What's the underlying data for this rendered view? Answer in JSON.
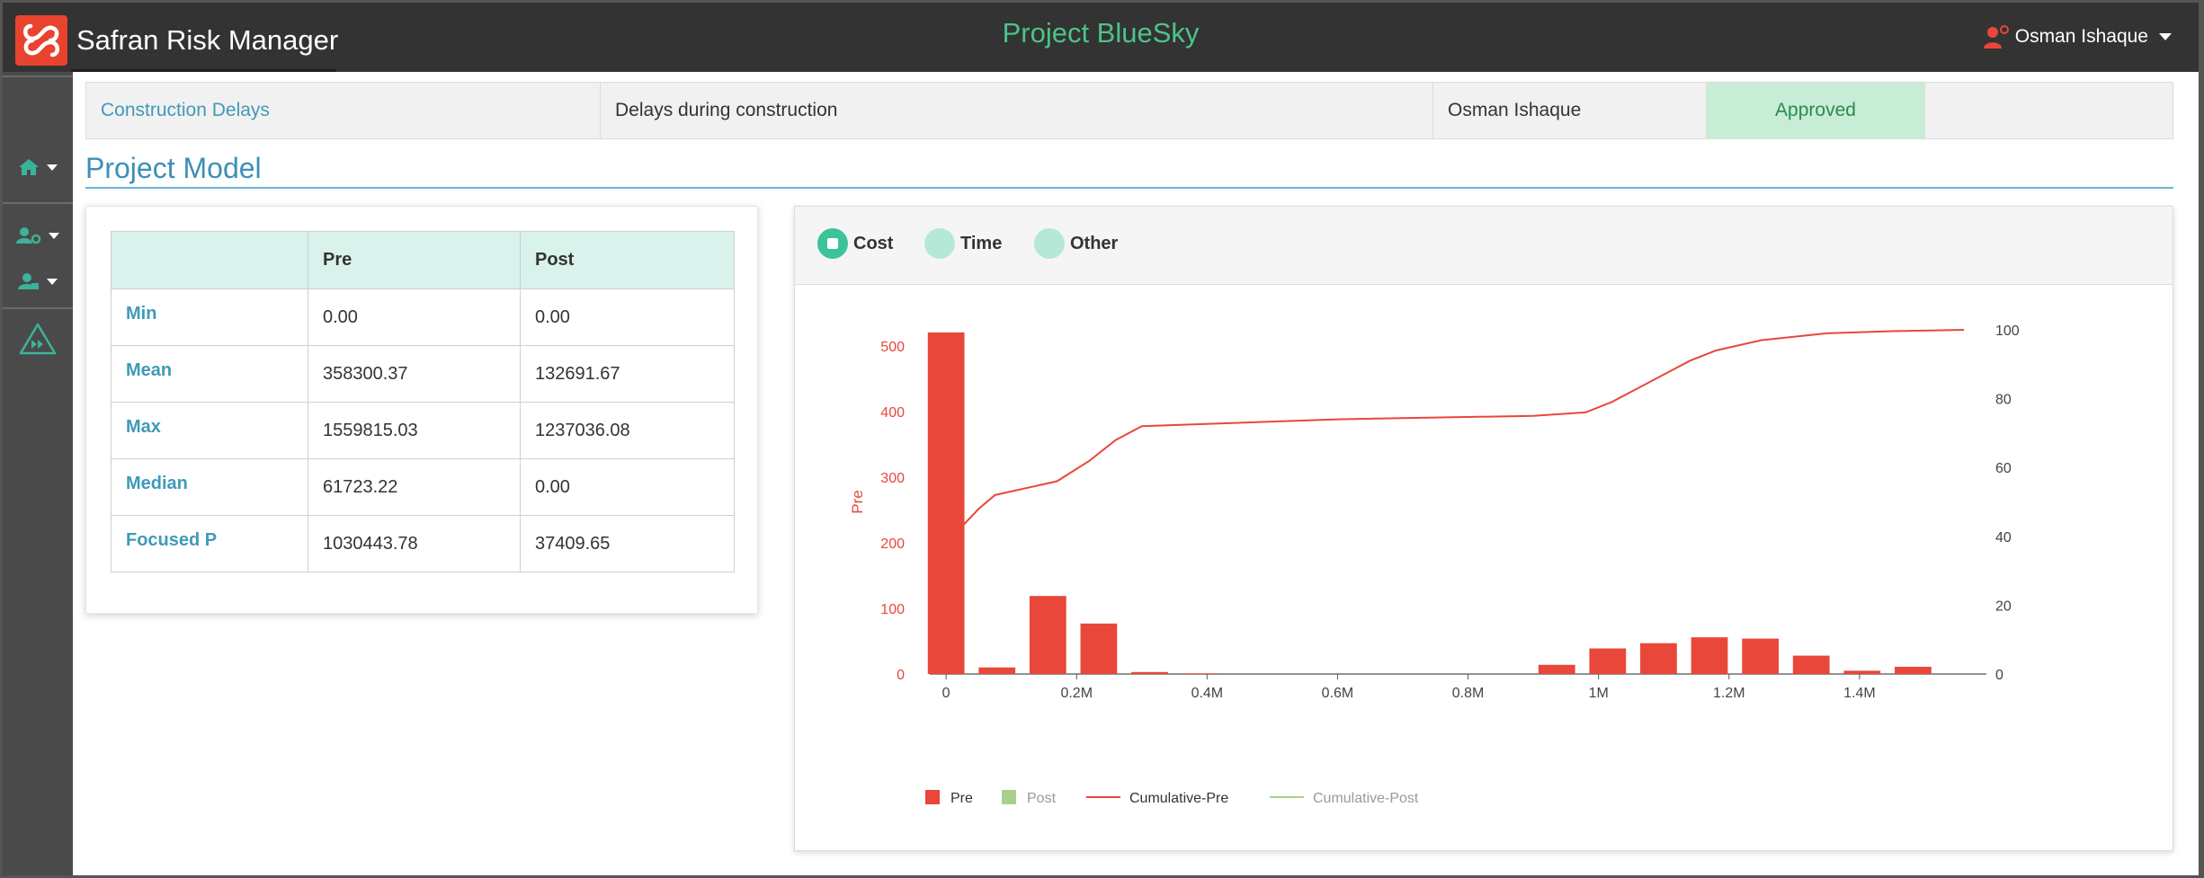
{
  "app": {
    "name": "Safran Risk Manager",
    "project_title": "Project BlueSky",
    "user_name": "Osman Ishaque"
  },
  "colors": {
    "topbar": "#333333",
    "accent_green": "#4cc38a",
    "accent_blue": "#3d8fb5",
    "pre_series": "#e8473a",
    "post_series": "#a8d08d",
    "status_bg": "#c8edd7"
  },
  "sidebar": {
    "items": [
      {
        "icon": "home-icon"
      },
      {
        "icon": "user-settings-icon"
      },
      {
        "icon": "users-icon"
      },
      {
        "icon": "fast-forward-triangle-icon"
      }
    ]
  },
  "risk": {
    "name": "Construction Delays",
    "description": "Delays during construction",
    "owner": "Osman Ishaque",
    "status": "Approved"
  },
  "section": {
    "title": "Project Model"
  },
  "stats": {
    "headers": [
      "",
      "Pre",
      "Post"
    ],
    "rows": [
      {
        "label": "Min",
        "pre": "0.00",
        "post": "0.00"
      },
      {
        "label": "Mean",
        "pre": "358300.37",
        "post": "132691.67"
      },
      {
        "label": "Max",
        "pre": "1559815.03",
        "post": "1237036.08"
      },
      {
        "label": "Median",
        "pre": "61723.22",
        "post": "0.00"
      },
      {
        "label": "Focused P",
        "pre": "1030443.78",
        "post": "37409.65"
      }
    ]
  },
  "chart_tabs": [
    {
      "label": "Cost",
      "active": true
    },
    {
      "label": "Time",
      "active": false
    },
    {
      "label": "Other",
      "active": false
    }
  ],
  "chart_data": {
    "type": "bar",
    "ylabel": "Pre",
    "x_ticks": [
      "0",
      "0.2M",
      "0.4M",
      "0.6M",
      "0.8M",
      "1M",
      "1.2M",
      "1.4M"
    ],
    "x_tick_values": [
      0,
      200000,
      400000,
      600000,
      800000,
      1000000,
      1200000,
      1400000
    ],
    "xlim": [
      -25000,
      1560000
    ],
    "y_left_ticks": [
      "0",
      "100",
      "200",
      "300",
      "400",
      "500"
    ],
    "ylim_left": [
      0,
      525
    ],
    "y_right_ticks": [
      "0",
      "20",
      "40",
      "60",
      "80",
      "100"
    ],
    "ylim_right": [
      0,
      100
    ],
    "bin_width": 78000,
    "series": [
      {
        "name": "Pre",
        "bin_centers": [
          0,
          78000,
          156000,
          234000,
          312000,
          390000,
          936000,
          1014000,
          1092000,
          1170000,
          1248000,
          1326000,
          1404000,
          1482000
        ],
        "values": [
          521,
          10,
          119,
          77,
          3,
          1,
          14,
          39,
          47,
          56,
          54,
          28,
          5,
          11,
          3
        ]
      },
      {
        "name": "Post",
        "bin_centers": [],
        "values": []
      }
    ],
    "cumulative": [
      {
        "name": "Cumulative-Pre",
        "x": [
          0,
          20000,
          50000,
          75000,
          170000,
          220000,
          260000,
          300000,
          600000,
          900000,
          980000,
          1020000,
          1060000,
          1100000,
          1140000,
          1180000,
          1250000,
          1350000,
          1450000,
          1560000
        ],
        "y": [
          35,
          42,
          48,
          52,
          56,
          62,
          68,
          72,
          74,
          75,
          76,
          79,
          83,
          87,
          91,
          94,
          97,
          99,
          99.6,
          100
        ]
      },
      {
        "name": "Cumulative-Post",
        "x": [],
        "y": []
      }
    ],
    "legend": [
      {
        "name": "Pre",
        "kind": "square",
        "color": "#e8473a",
        "muted": false
      },
      {
        "name": "Post",
        "kind": "square",
        "color": "#a8d08d",
        "muted": true
      },
      {
        "name": "Cumulative-Pre",
        "kind": "line",
        "color": "#e8473a",
        "muted": false
      },
      {
        "name": "Cumulative-Post",
        "kind": "line",
        "color": "#a8d08d",
        "muted": true
      }
    ],
    "legend_position": "bottom"
  }
}
